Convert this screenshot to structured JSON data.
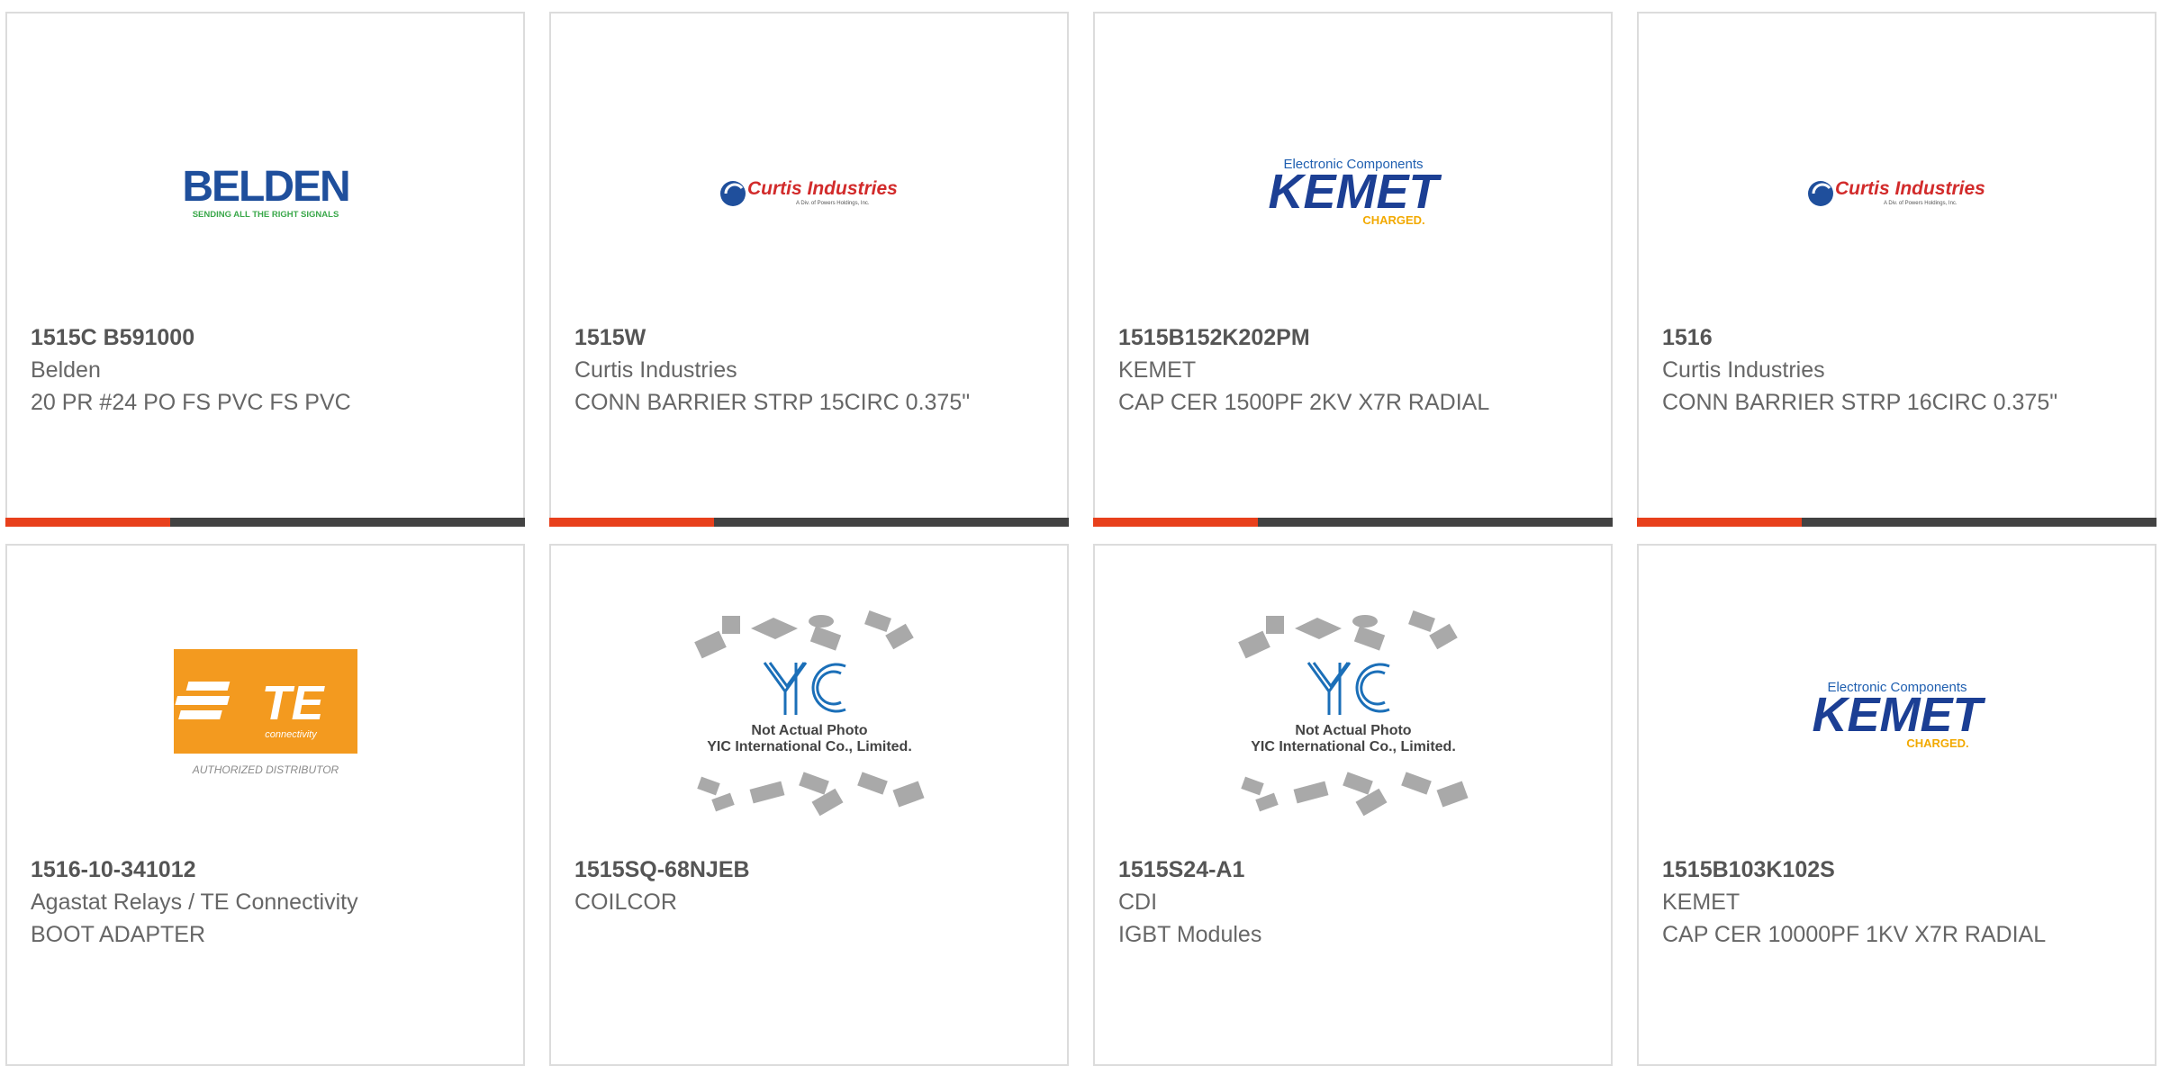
{
  "colors": {
    "accent": "#e8401c",
    "bar": "#424242",
    "border": "#dcdcdc",
    "text": "#666666"
  },
  "products": [
    {
      "part": "1515C B591000",
      "manufacturer": "Belden",
      "description": "20 PR #24 PO FS PVC FS PVC",
      "logo": "belden-logo",
      "logo_text": "BELDEN",
      "logo_tagline": "SENDING ALL THE RIGHT SIGNALS"
    },
    {
      "part": "1515W",
      "manufacturer": "Curtis Industries",
      "description": "CONN BARRIER STRP 15CIRC 0.375\"",
      "logo": "curtis-logo",
      "logo_text": "Curtis Industries",
      "logo_sub": "A Div. of Powers Holdings, Inc."
    },
    {
      "part": "1515B152K202PM",
      "manufacturer": "KEMET",
      "description": "CAP CER 1500PF 2KV X7R RADIAL",
      "logo": "kemet-logo",
      "logo_top": "Electronic Components",
      "logo_text": "KEMET",
      "logo_sub": "CHARGED."
    },
    {
      "part": "1516",
      "manufacturer": "Curtis Industries",
      "description": "CONN BARRIER STRP 16CIRC 0.375\"",
      "logo": "curtis-logo",
      "logo_text": "Curtis Industries",
      "logo_sub": "A Div. of Powers Holdings, Inc."
    },
    {
      "part": "1516-10-341012",
      "manufacturer": "Agastat Relays / TE Connectivity",
      "description": "BOOT ADAPTER",
      "logo": "te-logo",
      "logo_text": "TE",
      "logo_sub": "connectivity",
      "logo_footer": "AUTHORIZED DISTRIBUTOR"
    },
    {
      "part": "1515SQ-68NJEB",
      "manufacturer": "COILCOR",
      "description": "",
      "logo": "yic-placeholder",
      "logo_line1": "Not Actual Photo",
      "logo_line2": "YIC International Co., Limited."
    },
    {
      "part": "1515S24-A1",
      "manufacturer": "CDI",
      "description": "IGBT Modules",
      "logo": "yic-placeholder",
      "logo_line1": "Not Actual Photo",
      "logo_line2": "YIC International Co., Limited."
    },
    {
      "part": "1515B103K102S",
      "manufacturer": "KEMET",
      "description": "CAP CER 10000PF 1KV X7R RADIAL",
      "logo": "kemet-logo",
      "logo_top": "Electronic Components",
      "logo_text": "KEMET",
      "logo_sub": "CHARGED."
    }
  ]
}
